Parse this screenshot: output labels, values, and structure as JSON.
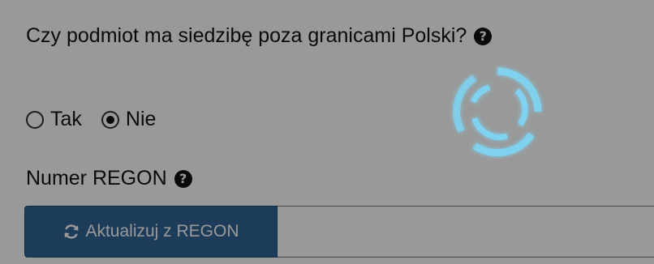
{
  "form": {
    "question": "Czy podmiot ma siedzibę poza granicami Polski?",
    "question_help_icon": "question-circle-icon",
    "radio_options": [
      {
        "label": "Tak",
        "selected": false
      },
      {
        "label": "Nie",
        "selected": true
      }
    ],
    "regon_label": "Numer REGON",
    "regon_help_icon": "question-circle-icon",
    "regon_button_label": "Aktualizuj z REGON",
    "regon_button_icon": "refresh-icon",
    "regon_input_value": ""
  },
  "overlay": {
    "loading_spinner": "spinner-icon",
    "spinner_color": "#7fd3f0"
  },
  "colors": {
    "button_bg": "#2f6496",
    "overlay": "rgba(0,0,0,0.40)"
  }
}
